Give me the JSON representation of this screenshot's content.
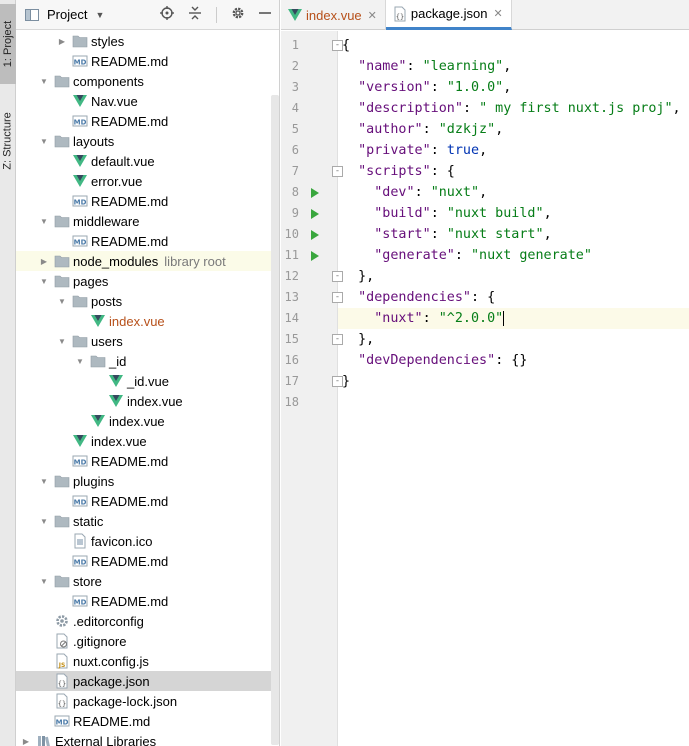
{
  "side_tabs": {
    "project": "1: Project",
    "structure": "Z: Structure"
  },
  "project_panel": {
    "title": "Project",
    "tree": [
      {
        "label": "styles",
        "depth": 2,
        "type": "folder",
        "arrow": "right"
      },
      {
        "label": "README.md",
        "depth": 2,
        "type": "md"
      },
      {
        "label": "components",
        "depth": 1,
        "type": "folder",
        "arrow": "down"
      },
      {
        "label": "Nav.vue",
        "depth": 2,
        "type": "vue"
      },
      {
        "label": "README.md",
        "depth": 2,
        "type": "md"
      },
      {
        "label": "layouts",
        "depth": 1,
        "type": "folder",
        "arrow": "down"
      },
      {
        "label": "default.vue",
        "depth": 2,
        "type": "vue"
      },
      {
        "label": "error.vue",
        "depth": 2,
        "type": "vue"
      },
      {
        "label": "README.md",
        "depth": 2,
        "type": "md"
      },
      {
        "label": "middleware",
        "depth": 1,
        "type": "folder",
        "arrow": "down"
      },
      {
        "label": "README.md",
        "depth": 2,
        "type": "md"
      },
      {
        "label": "node_modules",
        "depth": 1,
        "type": "folder",
        "arrow": "right",
        "note": "library root",
        "ext": true
      },
      {
        "label": "pages",
        "depth": 1,
        "type": "folder",
        "arrow": "down"
      },
      {
        "label": "posts",
        "depth": 2,
        "type": "folder",
        "arrow": "down"
      },
      {
        "label": "index.vue",
        "depth": 3,
        "type": "vue",
        "red": true
      },
      {
        "label": "users",
        "depth": 2,
        "type": "folder",
        "arrow": "down"
      },
      {
        "label": "_id",
        "depth": 3,
        "type": "folder",
        "arrow": "down"
      },
      {
        "label": "_id.vue",
        "depth": 4,
        "type": "vue"
      },
      {
        "label": "index.vue",
        "depth": 4,
        "type": "vue"
      },
      {
        "label": "index.vue",
        "depth": 3,
        "type": "vue"
      },
      {
        "label": "index.vue",
        "depth": 2,
        "type": "vue"
      },
      {
        "label": "README.md",
        "depth": 2,
        "type": "md"
      },
      {
        "label": "plugins",
        "depth": 1,
        "type": "folder",
        "arrow": "down"
      },
      {
        "label": "README.md",
        "depth": 2,
        "type": "md"
      },
      {
        "label": "static",
        "depth": 1,
        "type": "folder",
        "arrow": "down"
      },
      {
        "label": "favicon.ico",
        "depth": 2,
        "type": "ico"
      },
      {
        "label": "README.md",
        "depth": 2,
        "type": "md"
      },
      {
        "label": "store",
        "depth": 1,
        "type": "folder",
        "arrow": "down"
      },
      {
        "label": "README.md",
        "depth": 2,
        "type": "md"
      },
      {
        "label": ".editorconfig",
        "depth": 1,
        "type": "config"
      },
      {
        "label": ".gitignore",
        "depth": 1,
        "type": "gitignore"
      },
      {
        "label": "nuxt.config.js",
        "depth": 1,
        "type": "js"
      },
      {
        "label": "package.json",
        "depth": 1,
        "type": "json",
        "selected": true
      },
      {
        "label": "package-lock.json",
        "depth": 1,
        "type": "json"
      },
      {
        "label": "README.md",
        "depth": 1,
        "type": "md"
      },
      {
        "label": "External Libraries",
        "depth": 0,
        "type": "lib",
        "arrow": "right"
      }
    ]
  },
  "editor": {
    "tabs": [
      {
        "label": "index.vue",
        "type": "vue",
        "active": false
      },
      {
        "label": "package.json",
        "type": "json",
        "active": true
      }
    ],
    "lines": [
      {
        "n": "1",
        "fold": "-",
        "parts": [
          [
            "p",
            "{"
          ]
        ]
      },
      {
        "n": "2",
        "parts": [
          [
            "p",
            "  "
          ],
          [
            "k",
            "\"name\""
          ],
          [
            "p",
            ": "
          ],
          [
            "s",
            "\"learning\""
          ],
          [
            "p",
            ","
          ]
        ]
      },
      {
        "n": "3",
        "parts": [
          [
            "p",
            "  "
          ],
          [
            "k",
            "\"version\""
          ],
          [
            "p",
            ": "
          ],
          [
            "s",
            "\"1.0.0\""
          ],
          [
            "p",
            ","
          ]
        ]
      },
      {
        "n": "4",
        "parts": [
          [
            "p",
            "  "
          ],
          [
            "k",
            "\"description\""
          ],
          [
            "p",
            ": "
          ],
          [
            "s",
            "\" my first nuxt.js proj\""
          ],
          [
            "p",
            ","
          ]
        ]
      },
      {
        "n": "5",
        "parts": [
          [
            "p",
            "  "
          ],
          [
            "k",
            "\"author\""
          ],
          [
            "p",
            ": "
          ],
          [
            "s",
            "\"dzkjz\""
          ],
          [
            "p",
            ","
          ]
        ]
      },
      {
        "n": "6",
        "parts": [
          [
            "p",
            "  "
          ],
          [
            "k",
            "\"private\""
          ],
          [
            "p",
            ": "
          ],
          [
            "b",
            "true"
          ],
          [
            "p",
            ","
          ]
        ]
      },
      {
        "n": "7",
        "fold": "-",
        "parts": [
          [
            "p",
            "  "
          ],
          [
            "k",
            "\"scripts\""
          ],
          [
            "p",
            ": {"
          ]
        ]
      },
      {
        "n": "8",
        "run": true,
        "parts": [
          [
            "p",
            "    "
          ],
          [
            "k",
            "\"dev\""
          ],
          [
            "p",
            ": "
          ],
          [
            "s",
            "\"nuxt\""
          ],
          [
            "p",
            ","
          ]
        ]
      },
      {
        "n": "9",
        "run": true,
        "parts": [
          [
            "p",
            "    "
          ],
          [
            "k",
            "\"build\""
          ],
          [
            "p",
            ": "
          ],
          [
            "s",
            "\"nuxt build\""
          ],
          [
            "p",
            ","
          ]
        ]
      },
      {
        "n": "10",
        "run": true,
        "parts": [
          [
            "p",
            "    "
          ],
          [
            "k",
            "\"start\""
          ],
          [
            "p",
            ": "
          ],
          [
            "s",
            "\"nuxt start\""
          ],
          [
            "p",
            ","
          ]
        ]
      },
      {
        "n": "11",
        "run": true,
        "parts": [
          [
            "p",
            "    "
          ],
          [
            "k",
            "\"generate\""
          ],
          [
            "p",
            ": "
          ],
          [
            "s",
            "\"nuxt generate\""
          ]
        ]
      },
      {
        "n": "12",
        "fold": "-",
        "parts": [
          [
            "p",
            "  },"
          ]
        ]
      },
      {
        "n": "13",
        "fold": "-",
        "parts": [
          [
            "p",
            "  "
          ],
          [
            "k",
            "\"dependencies\""
          ],
          [
            "p",
            ": {"
          ]
        ]
      },
      {
        "n": "14",
        "current": true,
        "parts": [
          [
            "p",
            "    "
          ],
          [
            "k",
            "\"nuxt\""
          ],
          [
            "p",
            ": "
          ],
          [
            "s",
            "\"^2.0.0\""
          ]
        ]
      },
      {
        "n": "15",
        "fold": "-",
        "parts": [
          [
            "p",
            "  },"
          ]
        ]
      },
      {
        "n": "16",
        "parts": [
          [
            "p",
            "  "
          ],
          [
            "k",
            "\"devDependencies\""
          ],
          [
            "p",
            ": {}"
          ]
        ]
      },
      {
        "n": "17",
        "fold": "-",
        "parts": [
          [
            "p",
            "}"
          ]
        ]
      },
      {
        "n": "18",
        "parts": []
      }
    ]
  },
  "colors": {
    "key": "#660e7a",
    "string": "#067d17",
    "keyword": "#0033b3",
    "vue_green": "#41b883",
    "folder": "#aeb9c0",
    "run_green": "#39a63d"
  }
}
